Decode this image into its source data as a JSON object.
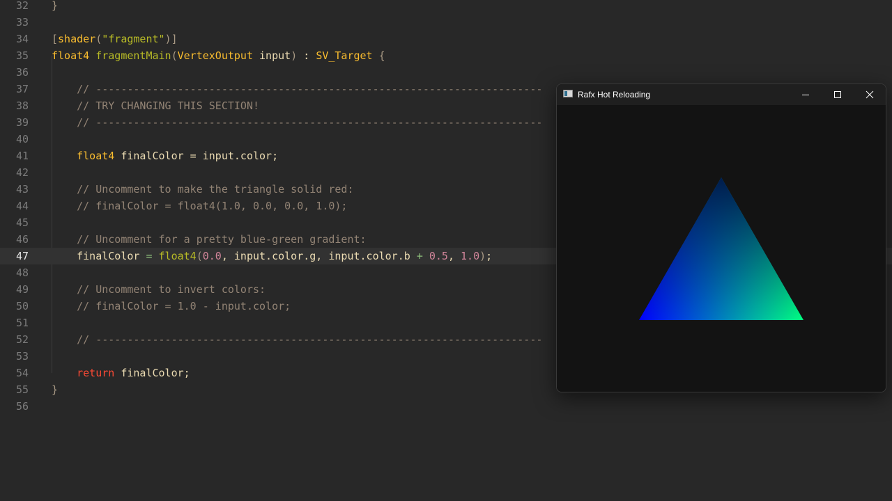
{
  "editor": {
    "lines": [
      {
        "num": "32",
        "tokens": [
          {
            "t": "}",
            "c": "t-br"
          }
        ]
      },
      {
        "num": "33",
        "tokens": []
      },
      {
        "num": "34",
        "tokens": [
          {
            "t": "[",
            "c": "t-br"
          },
          {
            "t": "shader",
            "c": "t-kw"
          },
          {
            "t": "(",
            "c": "t-br"
          },
          {
            "t": "\"fragment\"",
            "c": "t-str"
          },
          {
            "t": ")]",
            "c": "t-br"
          }
        ]
      },
      {
        "num": "35",
        "tokens": [
          {
            "t": "float4",
            "c": "t-kw"
          },
          {
            "t": " ",
            "c": "t-txt"
          },
          {
            "t": "fragmentMain",
            "c": "t-fn"
          },
          {
            "t": "(",
            "c": "t-br"
          },
          {
            "t": "VertexOutput",
            "c": "t-kw"
          },
          {
            "t": " input",
            "c": "t-txt"
          },
          {
            "t": ")",
            "c": "t-br"
          },
          {
            "t": " : ",
            "c": "t-txt"
          },
          {
            "t": "SV_Target",
            "c": "t-kw"
          },
          {
            "t": " {",
            "c": "t-br"
          }
        ]
      },
      {
        "num": "36",
        "tokens": []
      },
      {
        "num": "37",
        "tokens": [
          {
            "t": "    // -----------------------------------------------------------------------",
            "c": "t-cm"
          }
        ]
      },
      {
        "num": "38",
        "tokens": [
          {
            "t": "    // TRY CHANGING THIS SECTION!",
            "c": "t-cm"
          }
        ]
      },
      {
        "num": "39",
        "tokens": [
          {
            "t": "    // -----------------------------------------------------------------------",
            "c": "t-cm"
          }
        ]
      },
      {
        "num": "40",
        "tokens": []
      },
      {
        "num": "41",
        "tokens": [
          {
            "t": "    ",
            "c": "t-txt"
          },
          {
            "t": "float4",
            "c": "t-kw"
          },
          {
            "t": " finalColor = input.color;",
            "c": "t-txt"
          }
        ]
      },
      {
        "num": "42",
        "tokens": []
      },
      {
        "num": "43",
        "tokens": [
          {
            "t": "    // Uncomment to make the triangle solid red:",
            "c": "t-cm"
          }
        ]
      },
      {
        "num": "44",
        "tokens": [
          {
            "t": "    // finalColor = float4(1.0, 0.0, 0.0, 1.0);",
            "c": "t-cm"
          }
        ]
      },
      {
        "num": "45",
        "tokens": []
      },
      {
        "num": "46",
        "tokens": [
          {
            "t": "    // Uncomment for a pretty blue-green gradient:",
            "c": "t-cm"
          }
        ]
      },
      {
        "num": "47",
        "active": true,
        "tokens": [
          {
            "t": "    finalColor ",
            "c": "t-txt"
          },
          {
            "t": "=",
            "c": "t-op"
          },
          {
            "t": " ",
            "c": "t-txt"
          },
          {
            "t": "float4",
            "c": "t-fn"
          },
          {
            "t": "(",
            "c": "t-br"
          },
          {
            "t": "0.0",
            "c": "t-num"
          },
          {
            "t": ", input.color.g, input.color.b ",
            "c": "t-txt"
          },
          {
            "t": "+",
            "c": "t-op"
          },
          {
            "t": " ",
            "c": "t-txt"
          },
          {
            "t": "0.5",
            "c": "t-num"
          },
          {
            "t": ", ",
            "c": "t-txt"
          },
          {
            "t": "1.0",
            "c": "t-num"
          },
          {
            "t": ")",
            "c": "t-br"
          },
          {
            "t": ";",
            "c": "t-txt"
          }
        ]
      },
      {
        "num": "48",
        "tokens": []
      },
      {
        "num": "49",
        "tokens": [
          {
            "t": "    // Uncomment to invert colors:",
            "c": "t-cm"
          }
        ]
      },
      {
        "num": "50",
        "tokens": [
          {
            "t": "    // finalColor = 1.0 - input.color;",
            "c": "t-cm"
          }
        ]
      },
      {
        "num": "51",
        "tokens": []
      },
      {
        "num": "52",
        "tokens": [
          {
            "t": "    // -----------------------------------------------------------------------",
            "c": "t-cm"
          }
        ]
      },
      {
        "num": "53",
        "tokens": []
      },
      {
        "num": "54",
        "tokens": [
          {
            "t": "    ",
            "c": "t-txt"
          },
          {
            "t": "return",
            "c": "t-ret"
          },
          {
            "t": " finalColor;",
            "c": "t-txt"
          }
        ]
      },
      {
        "num": "55",
        "tokens": [
          {
            "t": "}",
            "c": "t-br"
          }
        ]
      },
      {
        "num": "56",
        "tokens": []
      }
    ]
  },
  "window": {
    "title": "Rafx Hot Reloading",
    "icons": {
      "app": "app-window-icon",
      "minimize": "minimize-icon",
      "maximize": "maximize-icon",
      "close": "close-icon"
    }
  },
  "render": {
    "triangle_colors": {
      "top": "#001c4c",
      "bottom_left": "#0000ff",
      "bottom_right": "#00ff80"
    }
  }
}
